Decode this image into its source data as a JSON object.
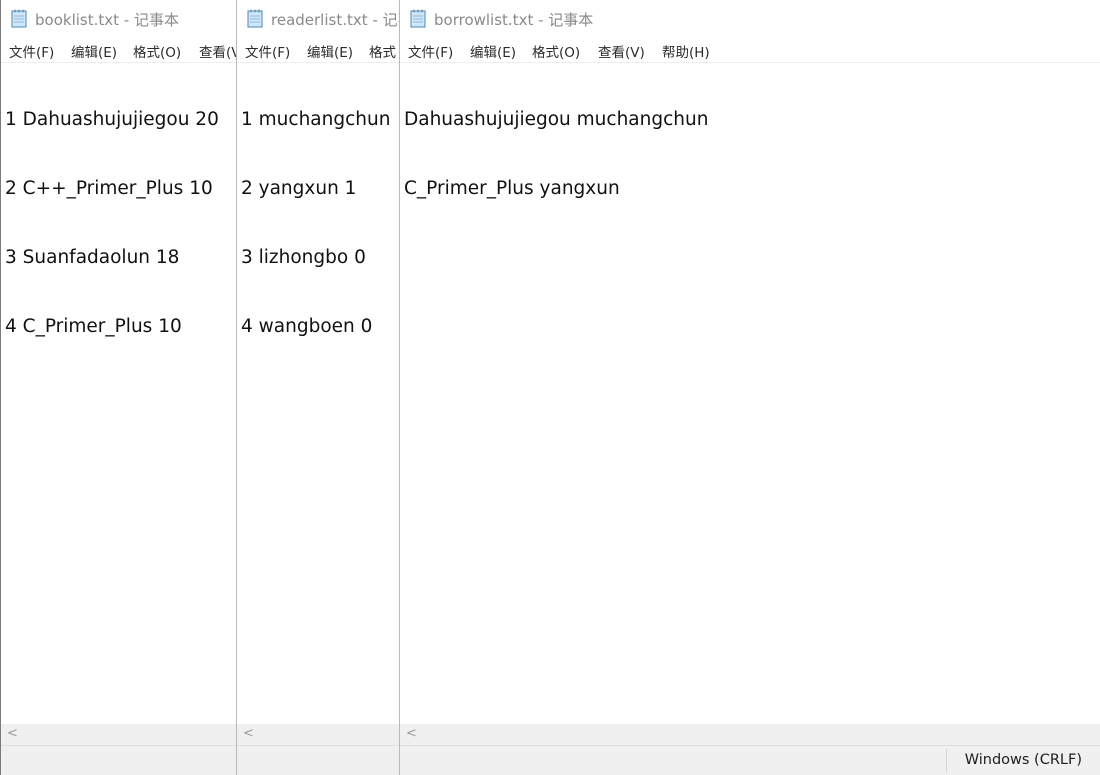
{
  "windows": [
    {
      "title": "booklist.txt - 记事本",
      "menu": [
        "文件(F)",
        "编辑(E)",
        "格式(O)",
        "查看(V)"
      ],
      "lines": [
        "1 Dahuashujujiegou 20",
        "2 C++_Primer_Plus 10",
        "3 Suanfadaolun 18",
        "4 C_Primer_Plus 10"
      ]
    },
    {
      "title": "readerlist.txt - 记事本",
      "menu": [
        "文件(F)",
        "编辑(E)",
        "格式"
      ],
      "lines": [
        "1 muchangchun",
        "2 yangxun 1",
        "3 lizhongbo 0",
        "4 wangboen 0"
      ]
    },
    {
      "title": "borrowlist.txt - 记事本",
      "menu": [
        "文件(F)",
        "编辑(E)",
        "格式(O)",
        "查看(V)",
        "帮助(H)"
      ],
      "lines": [
        "Dahuashujujiegou muchangchun",
        "C_Primer_Plus yangxun"
      ],
      "status": {
        "encoding": "Windows (CRLF)"
      }
    }
  ],
  "icons": {
    "app": "notepad-icon",
    "scroll_left": "scroll-left-arrow-icon"
  },
  "colors": {
    "title_text": "#8a8a8a",
    "menu_text": "#2b2b2b",
    "body_text": "#111111",
    "statusbar_bg": "#f0f0f0"
  }
}
